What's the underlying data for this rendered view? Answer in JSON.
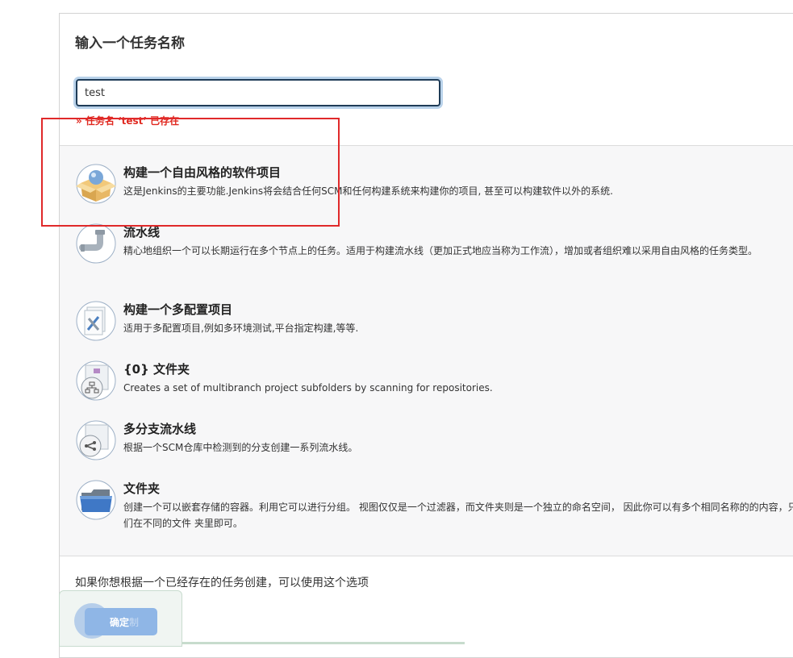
{
  "form": {
    "title": "输入一个任务名称",
    "name_input_value": "test",
    "error_message": "» 任务名 ‘test’ 已存在"
  },
  "job_types": [
    {
      "icon": "freestyle-box-icon",
      "title": "构建一个自由风格的软件项目",
      "description": "这是Jenkins的主要功能.Jenkins将会结合任何SCM和任何构建系统来构建你的项目, 甚至可以构建软件以外的系统."
    },
    {
      "icon": "pipeline-pipe-icon",
      "title": "流水线",
      "description": "精心地组织一个可以长期运行在多个节点上的任务。适用于构建流水线（更加正式地应当称为工作流），增加或者组织难以采用自由风格的任务类型。"
    },
    {
      "icon": "multi-config-icon",
      "title": "构建一个多配置项目",
      "description": "适用于多配置项目,例如多环境测试,平台指定构建,等等."
    },
    {
      "icon": "org-folder-icon",
      "title": "{0} 文件夹",
      "description": "Creates a set of multibranch project subfolders by scanning for repositories."
    },
    {
      "icon": "multibranch-icon",
      "title": "多分支流水线",
      "description": "根据一个SCM仓库中检测到的分支创建一系列流水线。"
    },
    {
      "icon": "folder-icon",
      "title": "文件夹",
      "description": "创建一个可以嵌套存储的容器。利用它可以进行分组。 视图仅仅是一个过滤器，而文件夹则是一个独立的命名空间， 因此你可以有多个相同名称的的内容，只要它们在不同的文件 夹里即可。"
    }
  ],
  "copy": {
    "label": "如果你想根据一个已经存在的任务创建，可以使用这个选项"
  },
  "footer": {
    "ok_label": "确定",
    "ok_ghost": "制"
  },
  "colors": {
    "error": "#e0281f",
    "highlight": "#e0292a",
    "input_border": "#1f3c57",
    "ok_button": "#8fb6e6"
  }
}
